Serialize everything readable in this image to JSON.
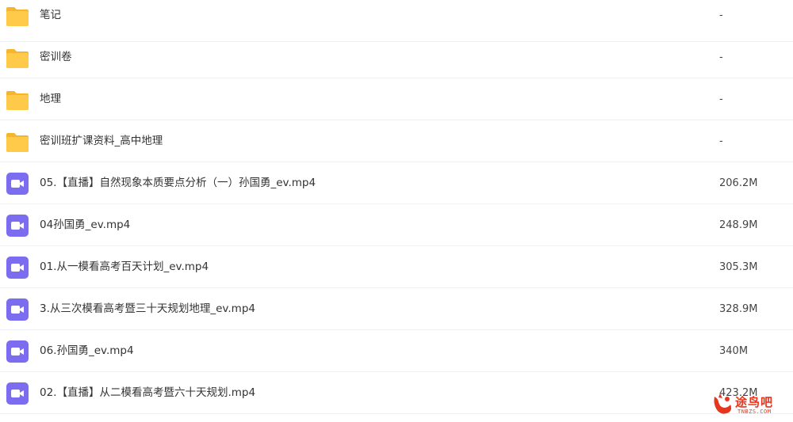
{
  "files": [
    {
      "type": "folder",
      "icon": "folder-icon",
      "name": "笔记",
      "size": "-"
    },
    {
      "type": "folder",
      "icon": "folder-icon",
      "name": "密训卷",
      "size": "-"
    },
    {
      "type": "folder",
      "icon": "folder-icon",
      "name": "地理",
      "size": "-"
    },
    {
      "type": "folder",
      "icon": "folder-icon",
      "name": "密训班扩课资料_高中地理",
      "size": "-"
    },
    {
      "type": "video",
      "icon": "video-file-icon",
      "name": "05.【直播】自然现象本质要点分析（一）孙国勇_ev.mp4",
      "size": "206.2M"
    },
    {
      "type": "video",
      "icon": "video-file-icon",
      "name": "04孙国勇_ev.mp4",
      "size": "248.9M"
    },
    {
      "type": "video",
      "icon": "video-file-icon",
      "name": "01.从一模看高考百天计划_ev.mp4",
      "size": "305.3M"
    },
    {
      "type": "video",
      "icon": "video-file-icon",
      "name": "3.从三次模看高考暨三十天规划地理_ev.mp4",
      "size": "328.9M"
    },
    {
      "type": "video",
      "icon": "video-file-icon",
      "name": "06.孙国勇_ev.mp4",
      "size": "340M"
    },
    {
      "type": "video",
      "icon": "video-file-icon",
      "name": "02.【直播】从二模看高考暨六十天规划.mp4",
      "size": "423.2M"
    }
  ],
  "watermark": {
    "title": "途鸟吧",
    "subtitle": "TNBZS.COM"
  },
  "colors": {
    "folder": "#FFC94A",
    "folder_tab": "#F5B52E",
    "video": "#7B6CF0",
    "watermark": "#E8351E",
    "divider": "#EEF0F3"
  }
}
